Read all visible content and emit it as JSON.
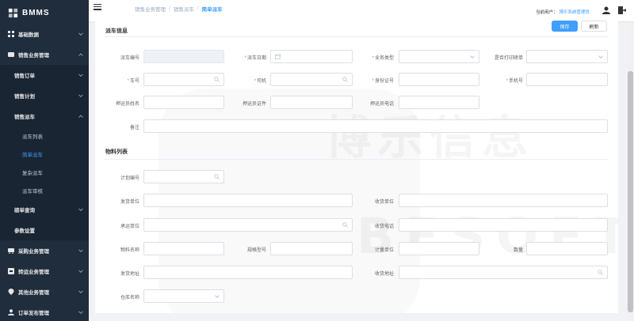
{
  "app": {
    "name": "BMMS"
  },
  "sidebar": {
    "items": [
      {
        "label": "基础数据",
        "icon": "grid-icon"
      },
      {
        "label": "销售业务管理",
        "icon": "folder-icon"
      },
      {
        "label": "销售订单"
      },
      {
        "label": "销售计划"
      },
      {
        "label": "销售派车"
      },
      {
        "label": "派车列表"
      },
      {
        "label": "简单派车"
      },
      {
        "label": "复杂派车"
      },
      {
        "label": "派车审核"
      },
      {
        "label": "磅单查询"
      },
      {
        "label": "参数设置"
      },
      {
        "label": "采购业务管理",
        "icon": "cart-icon"
      },
      {
        "label": "转运业务管理",
        "icon": "transfer-icon"
      },
      {
        "label": "其他业务管理",
        "icon": "location-icon"
      },
      {
        "label": "订单发布管理",
        "icon": "user-icon"
      }
    ]
  },
  "breadcrumb": {
    "level1": "销售业务管理",
    "level2": "销售派车",
    "current": "简单派车"
  },
  "user": {
    "label": "当前用户：",
    "name": "博乐系统管理员"
  },
  "dispatch": {
    "title": "派车信息",
    "save": "保存",
    "refresh": "刷新",
    "fields": {
      "dispatch_no": "派车编号",
      "dispatch_date": "派车日期",
      "business_type": "业务类型",
      "print_slip": "是否打印磅单",
      "plate_no": "车号",
      "driver": "司机",
      "id_no": "身份证号",
      "phone": "手机号",
      "escort_name": "押运员姓名",
      "escort_cert": "押运员证件",
      "escort_phone": "押运员电话",
      "remark": "备注"
    }
  },
  "materials": {
    "title": "物料列表",
    "fields": {
      "plan_no": "计划编号",
      "shipper": "发货单位",
      "receiver": "收货单位",
      "carrier": "承运单位",
      "receiver_phone": "收货电话",
      "material_name": "物料名称",
      "spec": "规格型号",
      "unit": "计量单位",
      "quantity": "数量",
      "ship_addr": "发货地址",
      "recv_addr": "收货地址",
      "warehouse": "仓库名称"
    }
  },
  "watermark": {
    "cn": "博乐信息",
    "en": "BESOFT"
  },
  "colors": {
    "sidebar": "#1f2d3d",
    "accent": "#409eff",
    "required": "#f56c6c"
  }
}
